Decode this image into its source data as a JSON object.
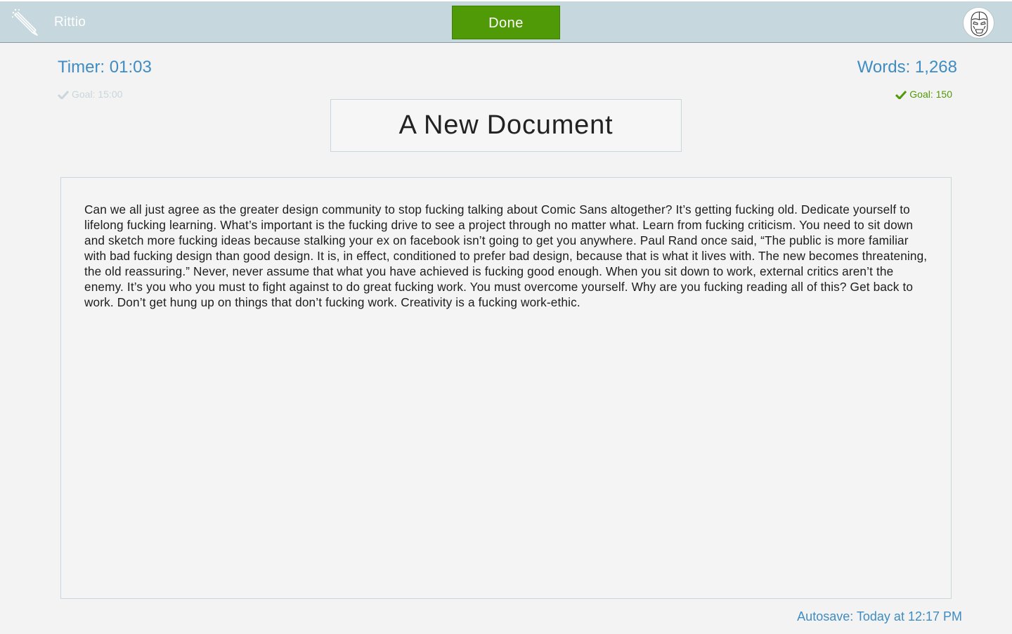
{
  "app": {
    "name": "Rittio",
    "logo_icon": "pencil-icon",
    "avatar_icon": "iron-man-helmet-icon"
  },
  "toolbar": {
    "done_label": "Done"
  },
  "stats": {
    "timer": "Timer: 01:03",
    "timer_goal": "Goal: 15:00",
    "timer_goal_met": false,
    "words": "Words: 1,268",
    "words_goal": "Goal: 150",
    "words_goal_met": true
  },
  "document": {
    "title": "A New Document",
    "body": "Can we all just agree as the greater design community to stop fucking talking about Comic Sans altogether? It’s getting fucking old. Dedicate yourself to lifelong fucking learning. What’s important is the fucking drive to see a project through no matter what. Learn from fucking criticism. You need to sit down and sketch more fucking ideas because stalking your ex on facebook isn’t going to get you anywhere. Paul Rand once said, “The public is more familiar with bad fucking design than good design. It is, in effect, conditioned to prefer bad design, because that is what it lives with. The new becomes threatening, the old reassuring.” Never, never assume that what you have achieved is fucking good enough. When you sit down to work, external critics aren’t the enemy. It’s you who you must to fight against to do great fucking work. You must overcome yourself. Why are you fucking reading all of this? Get back to work. Don’t get hung up on things that don’t fucking work. Creativity is a fucking work-ethic."
  },
  "footer": {
    "autosave": "Autosave: Today at 12:17 PM"
  },
  "colors": {
    "topbar": "#c6d8de",
    "accent_blue": "#3f8cc2",
    "done_green": "#4f9a06",
    "goal_met_green": "#4f9a06",
    "goal_pending": "#c9d6db",
    "background": "#f3f3f3"
  }
}
